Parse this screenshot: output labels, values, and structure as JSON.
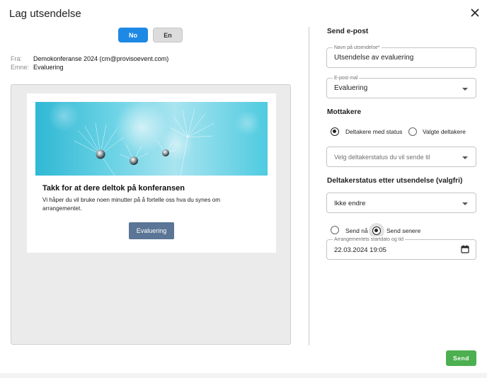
{
  "dialog": {
    "title": "Lag utsendelse",
    "close_icon": "close-icon"
  },
  "languages": {
    "no": "No",
    "en": "En",
    "selected": "No"
  },
  "meta": {
    "from_label": "Fra:",
    "from_value": "Demokonferanse 2024 (cm@provisoevent.com)",
    "subject_label": "Emne:",
    "subject_value": "Evaluering"
  },
  "email_preview": {
    "heading": "Takk for at dere deltok på konferansen",
    "body": "Vi håper du vil bruke noen minutter på å fortelle oss hva du synes om arrangementet.",
    "button_label": "Evaluering"
  },
  "send_email": {
    "section_title": "Send e-post",
    "name_label": "Navn på utsendelse*",
    "name_value": "Utsendelse av evaluering",
    "template_label": "E-post mal",
    "template_value": "Evaluering"
  },
  "recipients": {
    "section_title": "Mottakere",
    "option_status": "Deltakere med status",
    "option_selected": "Valgte deltakere",
    "selected": "Deltakere med status",
    "status_placeholder": "Velg deltakerstatus du vil sende til"
  },
  "after_status": {
    "section_title": "Deltakerstatus etter utsendelse (valgfri)",
    "value": "Ikke endre"
  },
  "timing": {
    "option_now": "Send nå",
    "option_later": "Send senere",
    "selected": "Send senere",
    "date_label": "Arrangementets startdato og tid",
    "date_value": "22.03.2024 19:05"
  },
  "footer": {
    "send_label": "Send"
  },
  "colors": {
    "primary": "#1e88e5",
    "send": "#4caf50",
    "email_button": "#5a7595"
  }
}
